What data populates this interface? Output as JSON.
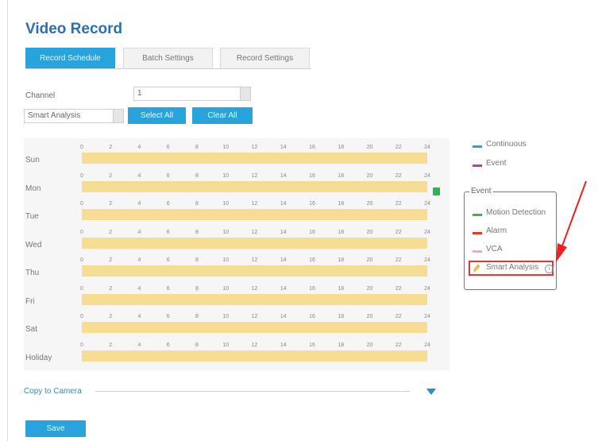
{
  "page_title": "Video Record",
  "tabs": [
    "Record Schedule",
    "Batch Settings",
    "Record Settings"
  ],
  "channel": {
    "label": "Channel",
    "value": "1"
  },
  "record_type": {
    "value": "Smart Analysis"
  },
  "buttons": {
    "select_all": "Select All",
    "clear_all": "Clear All",
    "save": "Save"
  },
  "schedule": {
    "hour_labels": [
      "0",
      "2",
      "4",
      "6",
      "8",
      "10",
      "12",
      "14",
      "16",
      "18",
      "20",
      "22",
      "24"
    ],
    "days": [
      "Sun",
      "Mon",
      "Tue",
      "Wed",
      "Thu",
      "Fri",
      "Sat",
      "Holiday"
    ]
  },
  "legend": {
    "continuous": "Continuous",
    "event": "Event",
    "event_group_title": "Event",
    "motion_detection": "Motion Detection",
    "alarm": "Alarm",
    "vca": "VCA",
    "smart_analysis": "Smart Analysis",
    "info_glyph": "i"
  },
  "colors": {
    "continuous": "#29a3dc",
    "event": "#b040b0",
    "motion_detection": "#3cb44b",
    "alarm": "#e8381e",
    "vca": "#f2a7c3",
    "smart_analysis": "#f7dc93"
  },
  "copy_to_camera": "Copy to Camera"
}
